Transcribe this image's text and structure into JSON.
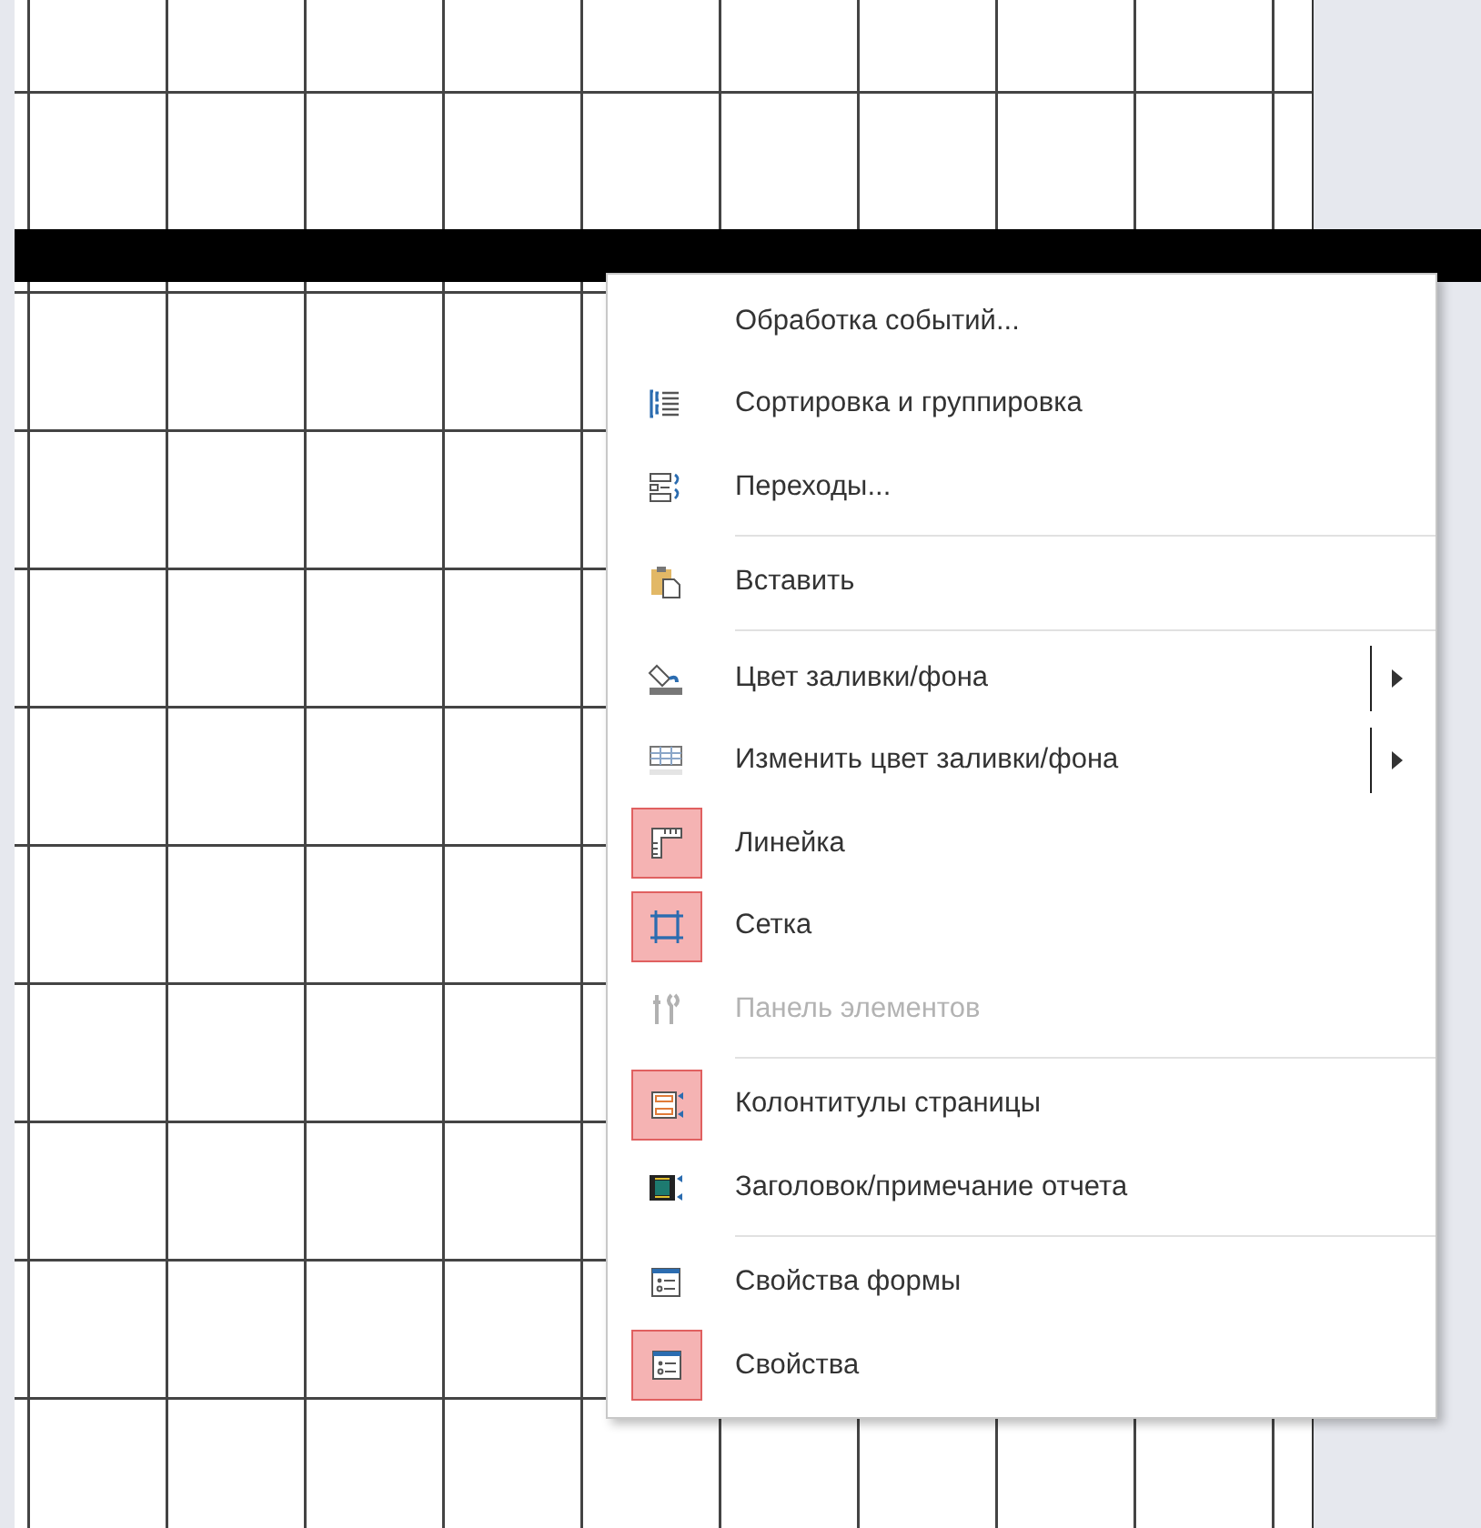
{
  "context_menu": {
    "items": [
      {
        "kind": "command",
        "label": "Обработка событий...",
        "disabled": false
      },
      {
        "kind": "command",
        "label": "Сортировка и группировка",
        "checked": false,
        "disabled": false
      },
      {
        "kind": "command",
        "label": "Переходы...",
        "checked": false,
        "disabled": false
      },
      {
        "kind": "separator"
      },
      {
        "kind": "command",
        "label": "Вставить",
        "checked": false,
        "disabled": false
      },
      {
        "kind": "separator"
      },
      {
        "kind": "submenu",
        "label": "Цвет заливки/фона",
        "checked": false,
        "disabled": false
      },
      {
        "kind": "submenu",
        "label": "Изменить цвет заливки/фона",
        "checked": false,
        "disabled": false
      },
      {
        "kind": "command",
        "label": "Линейка",
        "checked": true,
        "disabled": false
      },
      {
        "kind": "command",
        "label": "Сетка",
        "checked": true,
        "disabled": false
      },
      {
        "kind": "command",
        "label": "Панель элементов",
        "checked": false,
        "disabled": true
      },
      {
        "kind": "separator"
      },
      {
        "kind": "command",
        "label": "Колонтитулы страницы",
        "checked": true,
        "disabled": false
      },
      {
        "kind": "command",
        "label": "Заголовок/примечание отчета",
        "checked": false,
        "disabled": false
      },
      {
        "kind": "separator"
      },
      {
        "kind": "command",
        "label": "Свойства формы",
        "checked": false,
        "disabled": false
      },
      {
        "kind": "command",
        "label": "Свойства",
        "checked": true,
        "disabled": false
      }
    ]
  }
}
